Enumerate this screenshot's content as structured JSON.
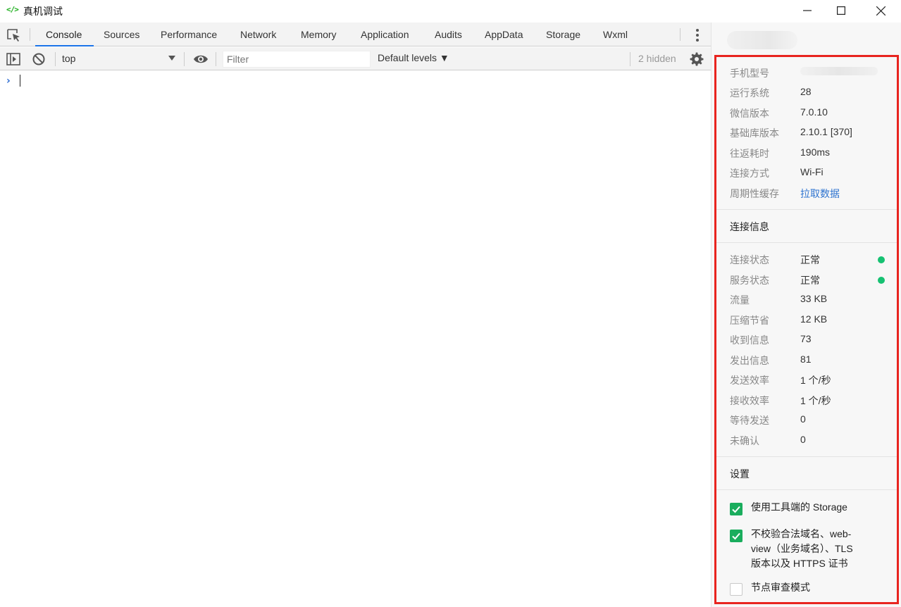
{
  "window": {
    "title": "真机调试",
    "app_icon": "code-icon",
    "accent_color": "#1aad19"
  },
  "devtools": {
    "tabs": [
      "Console",
      "Sources",
      "Performance",
      "Network",
      "Memory",
      "Application",
      "Audits",
      "AppData",
      "Storage",
      "Wxml"
    ],
    "active_tab": "Console",
    "toolbar": {
      "context": "top",
      "filter_placeholder": "Filter",
      "levels": "Default levels ▼",
      "hidden_count": "2 hidden"
    },
    "console": {
      "prompt": "›"
    }
  },
  "panel": {
    "device_info": [
      {
        "label": "手机型号",
        "value": ""
      },
      {
        "label": "运行系统",
        "value": "28"
      },
      {
        "label": "微信版本",
        "value": "7.0.10"
      },
      {
        "label": "基础库版本",
        "value": "2.10.1 [370]"
      },
      {
        "label": "往返耗时",
        "value": "190ms"
      },
      {
        "label": "连接方式",
        "value": "Wi-Fi"
      },
      {
        "label": "周期性缓存",
        "value": "拉取数据"
      }
    ],
    "connection_title": "连接信息",
    "connection_info": [
      {
        "label": "连接状态",
        "value": "正常"
      },
      {
        "label": "服务状态",
        "value": "正常"
      },
      {
        "label": "流量",
        "value": "33 KB"
      },
      {
        "label": "压缩节省",
        "value": "12 KB"
      },
      {
        "label": "收到信息",
        "value": "73"
      },
      {
        "label": "发出信息",
        "value": "81"
      },
      {
        "label": "发送效率",
        "value": "1 个/秒"
      },
      {
        "label": "接收效率",
        "value": "1 个/秒"
      },
      {
        "label": "等待发送",
        "value": "0"
      },
      {
        "label": "未确认",
        "value": "0"
      }
    ],
    "status_color": "#16c172",
    "settings_title": "设置",
    "settings": [
      {
        "label": "使用工具端的 Storage",
        "checked": true
      },
      {
        "label_lines": [
          "不校验合法域名、web-",
          "view（业务域名）、TLS",
          "版本以及 HTTPS 证书"
        ],
        "checked": true
      },
      {
        "label": "节点审查模式",
        "checked": false
      }
    ],
    "highlight_color": "#e8241f"
  }
}
